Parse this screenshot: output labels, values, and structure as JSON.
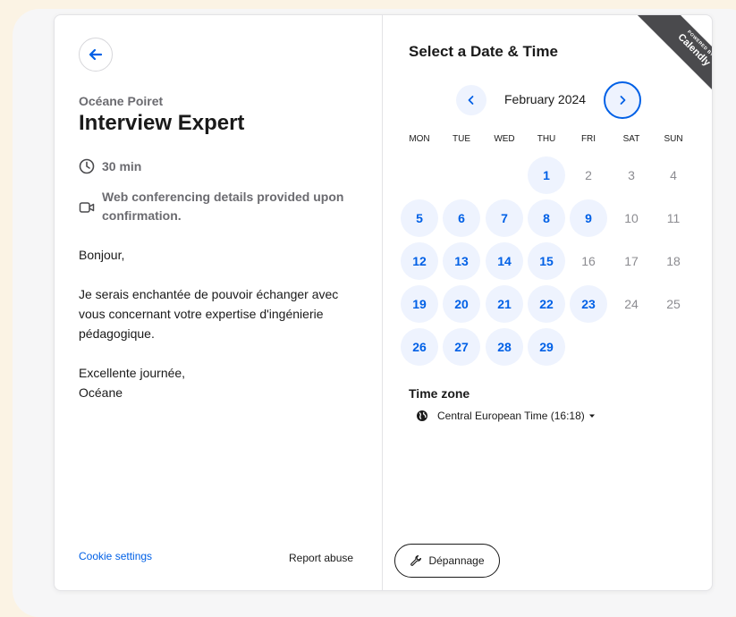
{
  "event": {
    "host": "Océane Poiret",
    "title": "Interview Expert",
    "duration": "30 min",
    "conferencing": "Web conferencing details provided upon confirmation.",
    "description": [
      "Bonjour,",
      "Je serais enchantée de pouvoir échanger avec vous concernant votre expertise d'ingénierie pédagogique.",
      "Excellente journée,\nOcéane"
    ]
  },
  "footer": {
    "cookie_settings": "Cookie settings",
    "report_abuse": "Report abuse",
    "troubleshoot": "Dépannage"
  },
  "calendar": {
    "heading": "Select a Date & Time",
    "month_label": "February 2024",
    "weekdays": [
      "MON",
      "TUE",
      "WED",
      "THU",
      "FRI",
      "SAT",
      "SUN"
    ],
    "first_weekday_index": 3,
    "days_in_month": 29,
    "available_days": [
      1,
      5,
      6,
      7,
      8,
      9,
      12,
      13,
      14,
      15,
      19,
      20,
      21,
      22,
      23,
      26,
      27,
      28,
      29
    ]
  },
  "timezone": {
    "label": "Time zone",
    "value": "Central European Time (16:18)"
  },
  "ribbon": {
    "powered_by": "POWERED BY",
    "brand": "Calendly"
  },
  "colors": {
    "accent": "#0060e6",
    "available_bg": "#eef3fe"
  },
  "icons": {
    "back": "arrow-left-icon",
    "duration": "clock-icon",
    "conferencing": "video-camera-icon",
    "prev": "chevron-left-icon",
    "next": "chevron-right-icon",
    "timezone": "globe-icon",
    "troubleshoot": "wrench-icon"
  }
}
